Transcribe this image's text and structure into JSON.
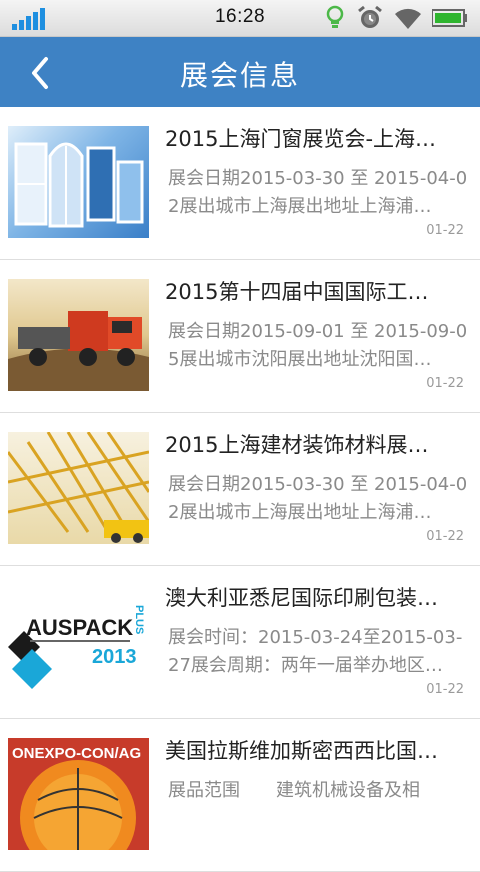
{
  "status_bar": {
    "time": "16:28",
    "icons": [
      "signal-icon",
      "bulb-icon",
      "alarm-icon",
      "wifi-icon",
      "battery-icon"
    ]
  },
  "header": {
    "title": "展会信息",
    "back_icon": "chevron-left-icon",
    "background": "#3e82c4"
  },
  "items": [
    {
      "title": "2015上海门窗展览会-上海…",
      "desc": "展会日期2015-03-30 至 2015-04-02展出城市上海展出地址上海浦…",
      "date": "01-22",
      "image": "windows-doors-photo"
    },
    {
      "title": "2015第十四届中国国际工…",
      "desc": "展会日期2015-09-01 至 2015-09-05展出城市沈阳展出地址沈阳国…",
      "date": "01-22",
      "image": "truck-photo"
    },
    {
      "title": "2015上海建材装饰材料展…",
      "desc": "展会日期2015-03-30 至 2015-04-02展出城市上海展出地址上海浦…",
      "date": "01-22",
      "image": "crane-photo"
    },
    {
      "title": "澳大利亚悉尼国际印刷包装…",
      "desc": "展会时间：2015-03-24至2015-03-27展会周期：两年一届举办地区…",
      "date": "01-22",
      "image": "auspack-logo",
      "logo_text": "AUSPACK",
      "logo_sub": "PLUS",
      "logo_year": "2013"
    },
    {
      "title": "美国拉斯维加斯密西西比国…",
      "desc": "展品范围　　建筑机械设备及相",
      "date": "",
      "image": "conexpo-logo",
      "logo_text": "ONEXPO-CON/AG"
    }
  ]
}
